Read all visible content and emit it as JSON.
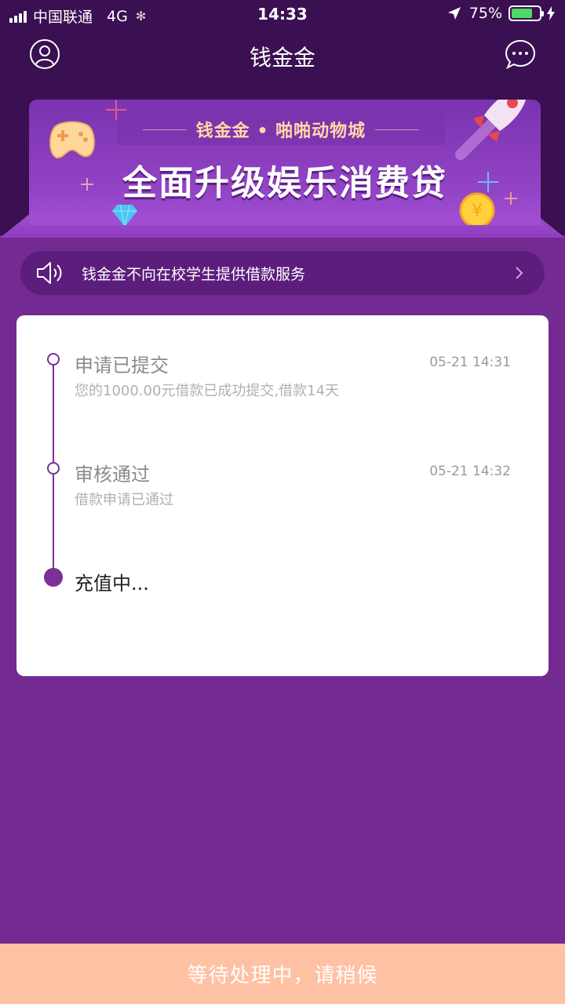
{
  "status_bar": {
    "carrier": "中国联通",
    "network": "4G",
    "time": "14:33",
    "battery": "75%"
  },
  "nav": {
    "title": "钱金金",
    "left_icon": "user-icon",
    "right_icon": "message-icon"
  },
  "banner": {
    "subtitle": "钱金金 • 啪啪动物城",
    "title": "全面升级娱乐消费贷"
  },
  "notice": {
    "text": "钱金金不向在校学生提供借款服务"
  },
  "timeline": {
    "steps": [
      {
        "title": "申请已提交",
        "time": "05-21 14:31",
        "desc": "您的1000.00元借款已成功提交,借款14天"
      },
      {
        "title": "审核通过",
        "time": "05-21 14:32",
        "desc": "借款申请已通过"
      },
      {
        "title": "充值中..."
      }
    ]
  },
  "bottom": {
    "label": "等待处理中，请稍候"
  },
  "colors": {
    "primary_purple": "#742a93",
    "dark_purple": "#3b1052",
    "bottom_bar": "#ffc1a3",
    "battery_green": "#4cd964"
  }
}
